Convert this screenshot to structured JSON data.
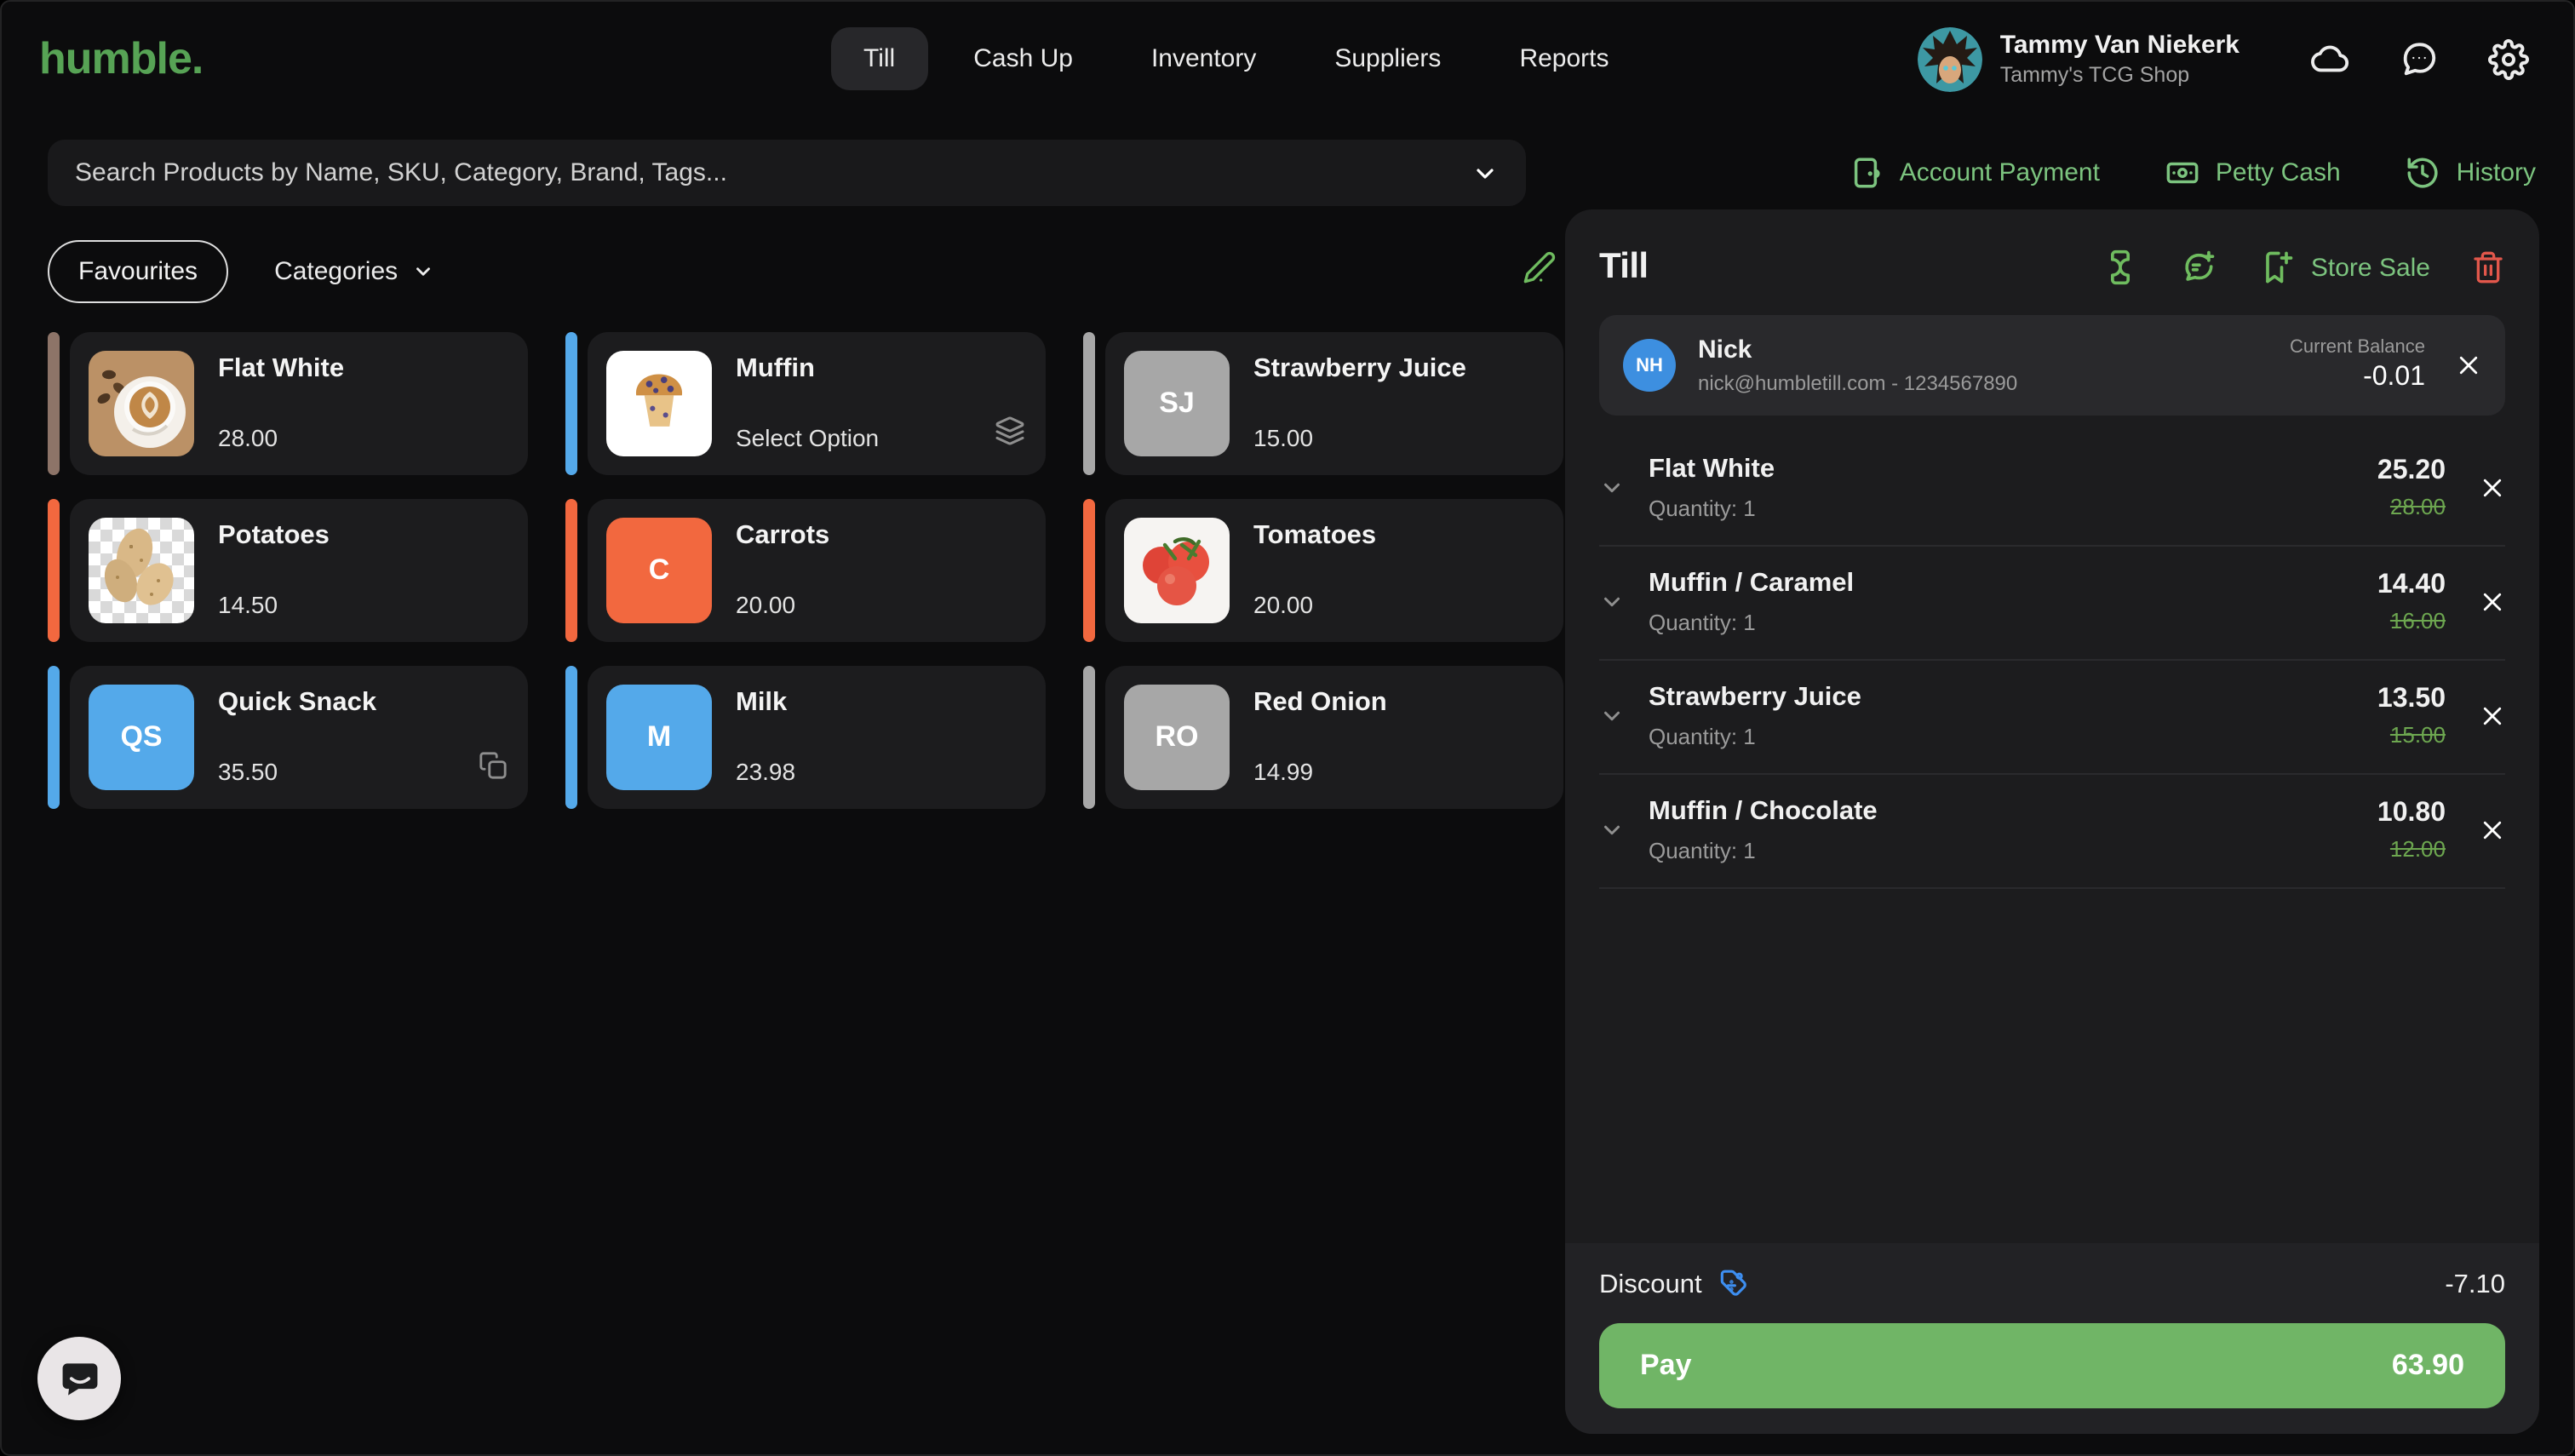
{
  "brand": {
    "logo": "humble.",
    "logo_color": "#57a355"
  },
  "nav": {
    "tabs": [
      {
        "label": "Till"
      },
      {
        "label": "Cash Up"
      },
      {
        "label": "Inventory"
      },
      {
        "label": "Suppliers"
      },
      {
        "label": "Reports"
      }
    ]
  },
  "user": {
    "name": "Tammy Van Niekerk",
    "shop": "Tammy's TCG Shop"
  },
  "search": {
    "placeholder": "Search Products by Name, SKU, Category, Brand, Tags..."
  },
  "quick_actions": {
    "account_payment": "Account Payment",
    "petty_cash": "Petty Cash",
    "history": "History",
    "color": "#7cc47f"
  },
  "filters": {
    "favourites": "Favourites",
    "categories": "Categories"
  },
  "products": [
    {
      "name": "Flat White",
      "price": "28.00",
      "accent": "#8d7468"
    },
    {
      "name": "Muffin",
      "price": "Select Option",
      "accent": "#54a9ea"
    },
    {
      "name": "Strawberry Juice",
      "price": "15.00",
      "accent": "#a7a7a7",
      "initials": "SJ",
      "tile_bg": "#a7a7a7"
    },
    {
      "name": "Potatoes",
      "price": "14.50",
      "accent": "#f2683f"
    },
    {
      "name": "Carrots",
      "price": "20.00",
      "accent": "#f2683f",
      "initials": "C",
      "tile_bg": "#f2683f"
    },
    {
      "name": "Tomatoes",
      "price": "20.00",
      "accent": "#f2683f"
    },
    {
      "name": "Quick Snack",
      "price": "35.50",
      "accent": "#54a9ea",
      "initials": "QS",
      "tile_bg": "#54a9ea"
    },
    {
      "name": "Milk",
      "price": "23.98",
      "accent": "#54a9ea",
      "initials": "M",
      "tile_bg": "#54a9ea"
    },
    {
      "name": "Red Onion",
      "price": "14.99",
      "accent": "#a7a7a7",
      "initials": "RO",
      "tile_bg": "#a7a7a7"
    }
  ],
  "till": {
    "title": "Till",
    "store_sale": "Store Sale",
    "customer": {
      "initials": "NH",
      "name": "Nick",
      "contact": "nick@humbletill.com - 1234567890",
      "balance_label": "Current Balance",
      "balance": "-0.01"
    },
    "items": [
      {
        "name": "Flat White",
        "quantity": "Quantity: 1",
        "price": "25.20",
        "original": "28.00"
      },
      {
        "name": "Muffin / Caramel",
        "quantity": "Quantity: 1",
        "price": "14.40",
        "original": "16.00"
      },
      {
        "name": "Strawberry Juice",
        "quantity": "Quantity: 1",
        "price": "13.50",
        "original": "15.00"
      },
      {
        "name": "Muffin / Chocolate",
        "quantity": "Quantity: 1",
        "price": "10.80",
        "original": "12.00"
      }
    ],
    "discount": {
      "label": "Discount",
      "value": "-7.10",
      "icon_color": "#3d8ef0"
    },
    "pay": {
      "label": "Pay",
      "amount": "63.90",
      "color": "#70b566"
    }
  }
}
